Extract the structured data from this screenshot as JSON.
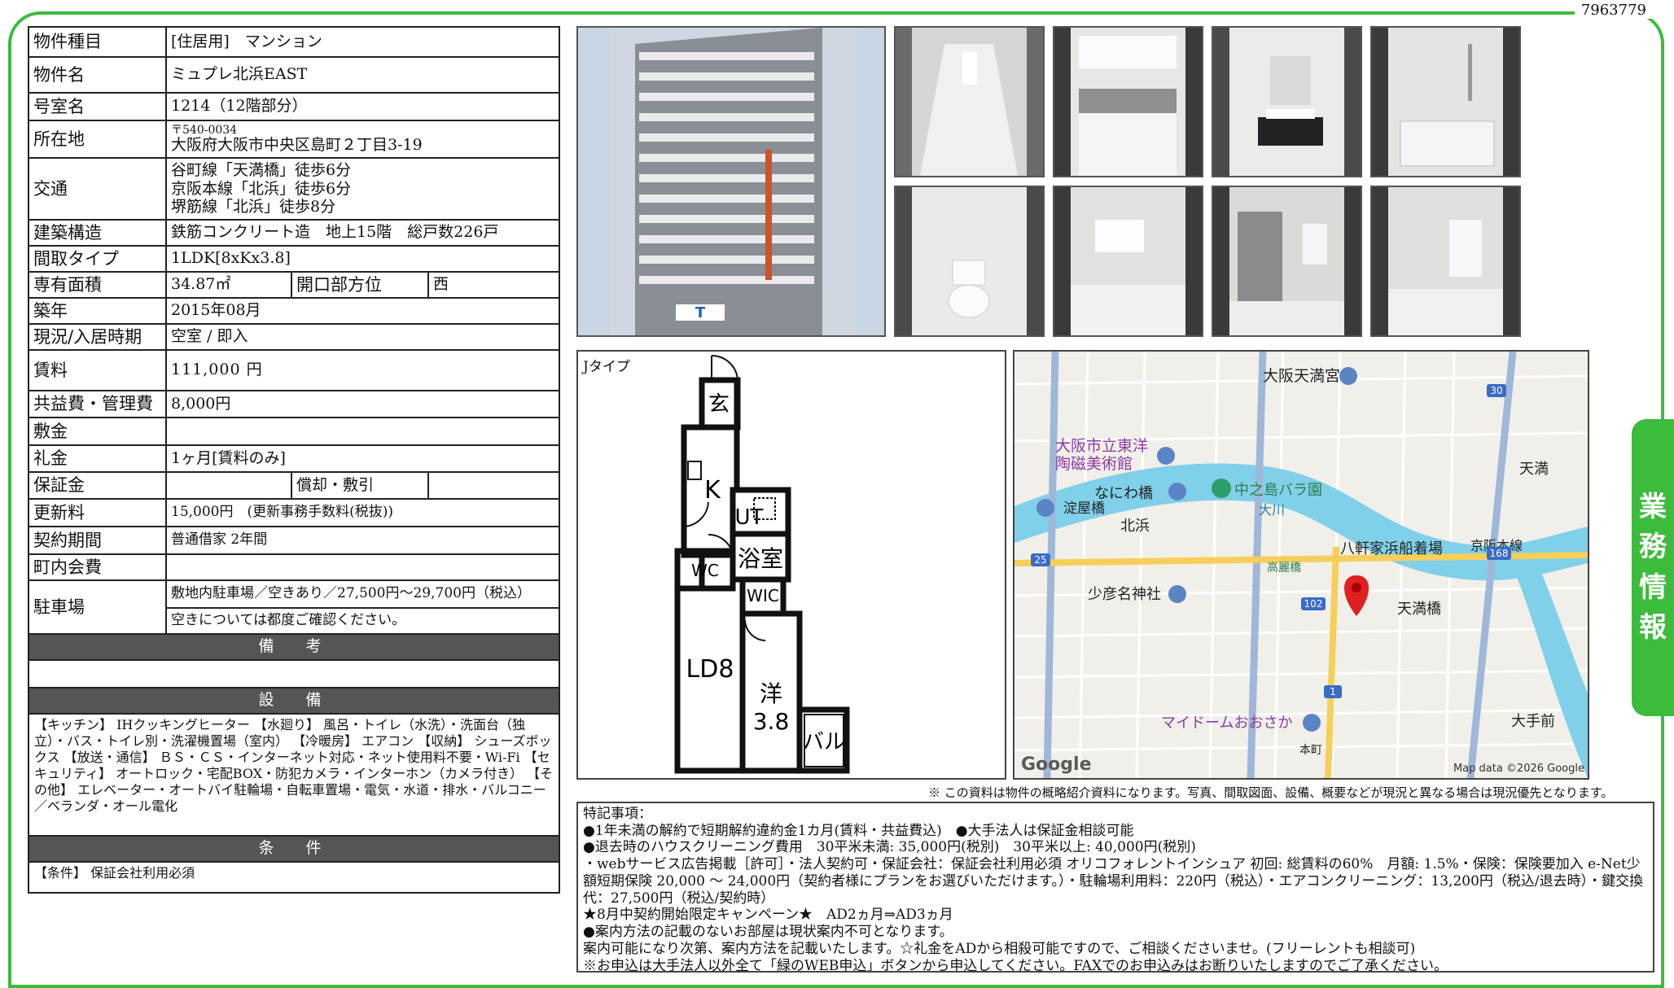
{
  "doc_id": "7963779",
  "sidetab": [
    "業",
    "務",
    "情",
    "報"
  ],
  "info": {
    "type_label": "物件種目",
    "type_value": "[住居用]　マンション",
    "name_label": "物件名",
    "name_value": "ミュプレ北浜EAST",
    "room_label": "号室名",
    "room_value": "1214（12階部分）",
    "address_label": "所在地",
    "address_zip": "〒540-0034",
    "address_value": "大阪府大阪市中央区島町２丁目3-19",
    "transit_label": "交通",
    "transit_lines": [
      "谷町線「天満橋」徒歩6分",
      "京阪本線「北浜」徒歩6分",
      "堺筋線「北浜」徒歩8分"
    ],
    "structure_label": "建築構造",
    "structure_value": "鉄筋コンクリート造　地上15階　総戸数226戸",
    "layout_label": "間取タイプ",
    "layout_value": "1LDK[8xKx3.8]",
    "area_label": "専有面積",
    "area_value": "34.87㎡",
    "direction_label": "開口部方位",
    "direction_value": "西",
    "built_label": "築年",
    "built_value": "2015年08月",
    "status_label": "現況/入居時期",
    "status_value": "空室 / 即入",
    "rent_label": "賃料",
    "rent_value": "111,000 円",
    "fee_label": "共益費・管理費",
    "fee_value": "8,000円",
    "deposit_label": "敷金",
    "deposit_value": "",
    "keymoney_label": "礼金",
    "keymoney_value": "1ヶ月[賃料のみ]",
    "guarantee_label": "保証金",
    "guarantee_value": "",
    "amort_label": "償却・敷引",
    "amort_value": "",
    "renewal_label": "更新料",
    "renewal_value": "15,000円　(更新事務手数料(税抜))",
    "contract_label": "契約期間",
    "contract_value": "普通借家 2年間",
    "town_label": "町内会費",
    "town_value": "",
    "parking_label": "駐車場",
    "parking_value1": "敷地内駐車場／空きあり／27,500円〜29,700円（税込）",
    "parking_value2": "空きについては都度ご確認ください。",
    "remarks_head": "備　考",
    "equip_head": "設　備",
    "equip_text": "【キッチン】 IHクッキングヒーター 【水廻り】 風呂・トイレ（水洗）・洗面台（独立）・バス・トイレ別・洗濯機置場（室内） 【冷暖房】 エアコン 【収納】 シューズボックス 【放送・通信】 ＢＳ・ＣＳ・インターネット対応・ネット使用料不要・Wi-Fi 【セキュリティ】 オートロック・宅配BOX・防犯カメラ・インターホン（カメラ付き） 【その他】 エレベーター・オートバイ駐輪場・自転車置場・電気・水道・排水・バルコニー／ベランダ・オール電化",
    "cond_head": "条　件",
    "cond_text": "【条件】 保証会社利用必須"
  },
  "floorplan": {
    "title": "Jタイプ",
    "rooms": {
      "genkan": "玄",
      "kitchen": "K",
      "ut": "UT",
      "wc": "WC",
      "bath": "浴室",
      "wic": "WIC",
      "ld": "LD8",
      "western": "洋",
      "western_size": "3.8",
      "balcony": "バル"
    }
  },
  "map": {
    "labels": [
      "大阪天満宮",
      "大阪市立東洋",
      "陶磁美術館",
      "なにわ橋",
      "中之島バラ園",
      "淀屋橋",
      "北浜",
      "大川",
      "八軒家浜船着場",
      "京阪本線",
      "少彦名神社",
      "天満橋",
      "マイドームおおさか",
      "天満",
      "大手前",
      "本町",
      "高麗橋"
    ],
    "roads": [
      "30",
      "25",
      "168",
      "102",
      "1"
    ],
    "google": "Google",
    "copyright": "Map data ©2026 Google"
  },
  "disclaimer": "※ この資料は物件の概略紹介資料になります。写真、間取図面、設備、概要などが現況と異なる場合は現況優先となります。",
  "remarks": [
    "特記事項：",
    "●1年未満の解約で短期解約違約金1カ月(賃料・共益費込)　●大手法人は保証金相談可能",
    "●退去時のハウスクリーニング費用　30平米未満: 35,000円(税別)　30平米以上: 40,000円(税別)",
    "・webサービス広告掲載［許可］・法人契約可・保証会社：保証会社利用必須 オリコフォレントインシュア 初回: 総賃料の60%　月額: 1.5%・保険：保険要加入 e-Net少額短期保険 20,000 〜 24,000円（契約者様にプランをお選びいただけます。）・駐輪場利用料：220円（税込）・エアコンクリーニング：13,200円（税込/退去時）・鍵交換代：27,500円（税込/契約時）",
    "★8月中契約開始限定キャンペーン★　AD2ヵ月⇒AD3ヵ月",
    "●案内方法の記載のないお部屋は現状案内不可となります。",
    "案内可能になり次第、案内方法を記載いたします。☆礼金をADから相殺可能ですので、ご相談くださいませ。(フリーレントも相談可)",
    "※お申込は大手法人以外全て「緑のWEB申込」ボタンから申込してください。FAXでのお申込みはお断りいたしますのでご了承ください。"
  ],
  "colors": {
    "accent": "#3dbb3d",
    "header_bg": "#555555",
    "pin": "#e02020"
  }
}
